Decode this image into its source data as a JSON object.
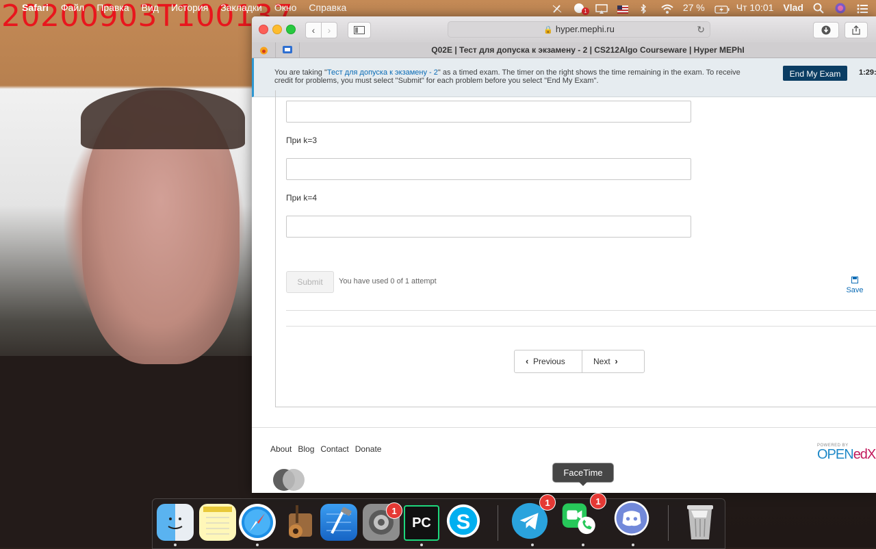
{
  "webcam": {
    "timestamp": "20200903T100137"
  },
  "menubar": {
    "apple_glyph": "",
    "app_name": "Safari",
    "menus": [
      "Файл",
      "Правка",
      "Вид",
      "История",
      "Закладки",
      "Окно",
      "Справка"
    ],
    "battery": "27 %",
    "clock": "Чт 10:01",
    "user": "Vlad",
    "notification_badge": "1",
    "icons": [
      "pen-slash-icon",
      "notification-icon",
      "airplay-icon",
      "flag-us-icon",
      "bluetooth-icon",
      "wifi-icon",
      "battery-icon",
      "search-icon",
      "siri-icon",
      "list-icon"
    ]
  },
  "browser": {
    "url": "hyper.mephi.ru",
    "tab_title": "Q02E | Тест для допуска к экзамену - 2 | CS212Algo Courseware | Hyper MEPhI"
  },
  "exam_banner": {
    "text_before": "You are taking \"",
    "exam_link": "Тест для допуска к экзамену - 2",
    "text_after": "\" as a timed exam. The timer on the right shows the time remaining in the exam. To receive credit for problems, you must select \"Submit\" for each problem before you select \"End My Exam\".",
    "end_button": "End My Exam",
    "timer": "1:29:"
  },
  "problem": {
    "labels": [
      "При k=3",
      "При k=4"
    ],
    "submit": "Submit",
    "attempts": "You have used 0 of 1 attempt",
    "save": "Save"
  },
  "pager": {
    "previous": "Previous",
    "next": "Next"
  },
  "footer": {
    "links": [
      "About",
      "Blog",
      "Contact",
      "Donate"
    ],
    "powered_by": "POWERED BY",
    "openedx_main": "OPEN",
    "openedx_accent": "edX"
  },
  "dock": {
    "tooltip": "FaceTime",
    "badges": {
      "system_preferences": "1",
      "telegram": "1",
      "facetime": "1"
    },
    "apps": [
      "Finder",
      "Notes",
      "Safari",
      "GarageBand",
      "Xcode",
      "System Preferences",
      "PyCharm",
      "Skype",
      "Telegram",
      "FaceTime",
      "Discord",
      "Trash"
    ]
  }
}
